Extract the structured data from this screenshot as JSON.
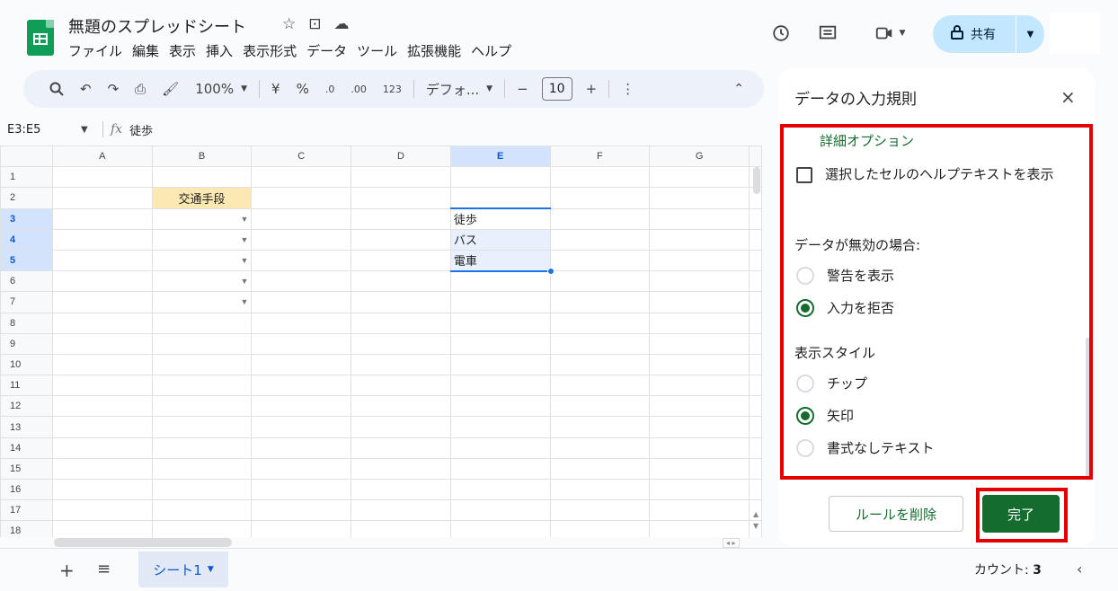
{
  "app": {
    "title": "無題のスプレッドシート",
    "icons": [
      "star-icon",
      "move-to-folder-icon",
      "cloud-saved-icon"
    ]
  },
  "menu": [
    "ファイル",
    "編集",
    "表示",
    "挿入",
    "表示形式",
    "データ",
    "ツール",
    "拡張機能",
    "ヘルプ"
  ],
  "header_right": {
    "share_label": "共有"
  },
  "toolbar": {
    "zoom": "100%",
    "currency": "¥",
    "percent": "%",
    "decrease_decimal": ".0",
    "increase_decimal": ".00",
    "number_format": "123",
    "font": "デフォ...",
    "font_size": "10",
    "minus": "−",
    "plus": "+"
  },
  "formula_bar": {
    "namebox": "E3:E5",
    "fx": "fx",
    "content": "徒歩"
  },
  "grid": {
    "columns": [
      "A",
      "B",
      "C",
      "D",
      "E",
      "F",
      "G"
    ],
    "rows": [
      "1",
      "2",
      "3",
      "4",
      "5",
      "6",
      "7",
      "8",
      "9",
      "10",
      "11",
      "12",
      "13",
      "14",
      "15",
      "16",
      "17",
      "18"
    ],
    "b2_header": "交通手段",
    "e_values": [
      "徒歩",
      "バス",
      "電車"
    ],
    "dropdown_glyph": "▼"
  },
  "bottom": {
    "add": "+",
    "all_sheets": "≡",
    "sheet_tab": "シート1",
    "count_label": "カウント:",
    "count_value": "3"
  },
  "panel": {
    "title": "データの入力規則",
    "close": "×",
    "advanced_options": "詳細オプション",
    "help_text_checkbox": "選択したセルのヘルプテキストを表示",
    "invalid_label": "データが無効の場合:",
    "invalid_options": [
      {
        "label": "警告を表示",
        "selected": false
      },
      {
        "label": "入力を拒否",
        "selected": true
      }
    ],
    "style_label": "表示スタイル",
    "style_options": [
      {
        "label": "チップ",
        "selected": false
      },
      {
        "label": "矢印",
        "selected": true
      },
      {
        "label": "書式なしテキスト",
        "selected": false
      }
    ],
    "delete_button": "ルールを削除",
    "done_button": "完了"
  },
  "colors": {
    "accent_green": "#146c2e",
    "highlight_red": "#e50000",
    "selection_blue": "#1a73e8",
    "header_fill": "#fce8b2"
  }
}
